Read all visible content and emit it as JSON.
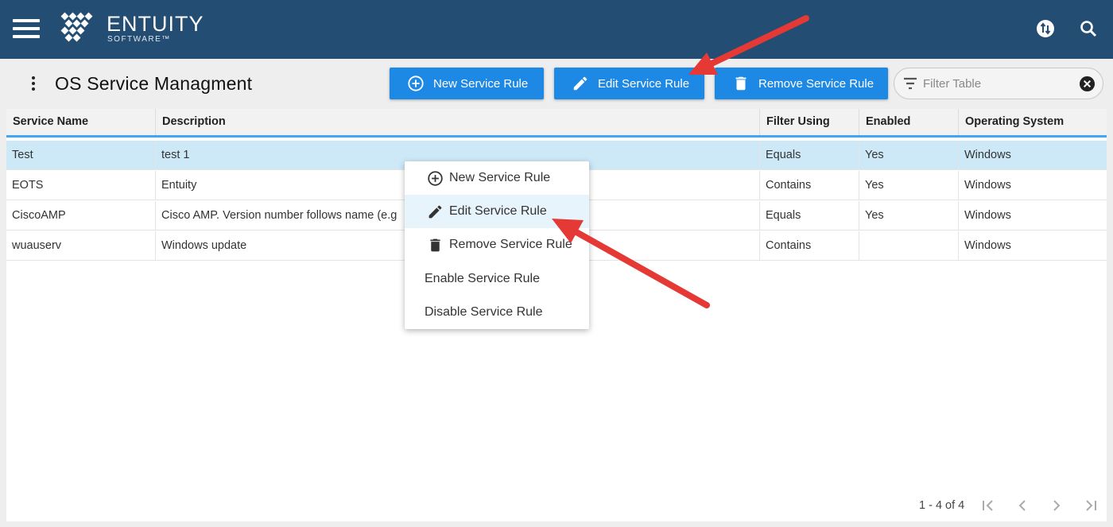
{
  "app": {
    "brand": "ENTUITY",
    "brand_sub": "SOFTWARE™"
  },
  "topbar": {
    "icons": [
      "menu-icon",
      "sync-icon",
      "search-icon"
    ]
  },
  "page": {
    "title": "OS Service Managment"
  },
  "toolbar": {
    "new_label": "New Service Rule",
    "edit_label": "Edit Service Rule",
    "remove_label": "Remove Service Rule",
    "filter_placeholder": "Filter Table"
  },
  "table": {
    "columns": [
      "Service Name",
      "Description",
      "Filter Using",
      "Enabled",
      "Operating System"
    ],
    "rows": [
      {
        "name": "Test",
        "description": "test 1",
        "filter": "Equals",
        "enabled": "Yes",
        "os": "Windows"
      },
      {
        "name": "EOTS",
        "description": "Entuity",
        "filter": "Contains",
        "enabled": "Yes",
        "os": "Windows"
      },
      {
        "name": "CiscoAMP",
        "description": "Cisco AMP. Version number follows name (e.g",
        "filter": "Equals",
        "enabled": "Yes",
        "os": "Windows"
      },
      {
        "name": "wuauserv",
        "description": "Windows update",
        "filter": "Contains",
        "enabled": "",
        "os": "Windows"
      }
    ]
  },
  "pager": {
    "range": "1 - 4 of 4"
  },
  "context_menu": {
    "items": [
      {
        "label": "New Service Rule",
        "icon": "add-circle-icon"
      },
      {
        "label": "Edit Service Rule",
        "icon": "pencil-icon"
      },
      {
        "label": "Remove Service Rule",
        "icon": "trash-icon"
      },
      {
        "label": "Enable Service Rule",
        "icon": ""
      },
      {
        "label": "Disable Service Rule",
        "icon": ""
      }
    ]
  },
  "colors": {
    "topbar": "#234d72",
    "button": "#1e88e5",
    "selected_row": "#cde9f8",
    "header_underline": "#42a5f5",
    "annotation_arrow": "#e53935"
  }
}
